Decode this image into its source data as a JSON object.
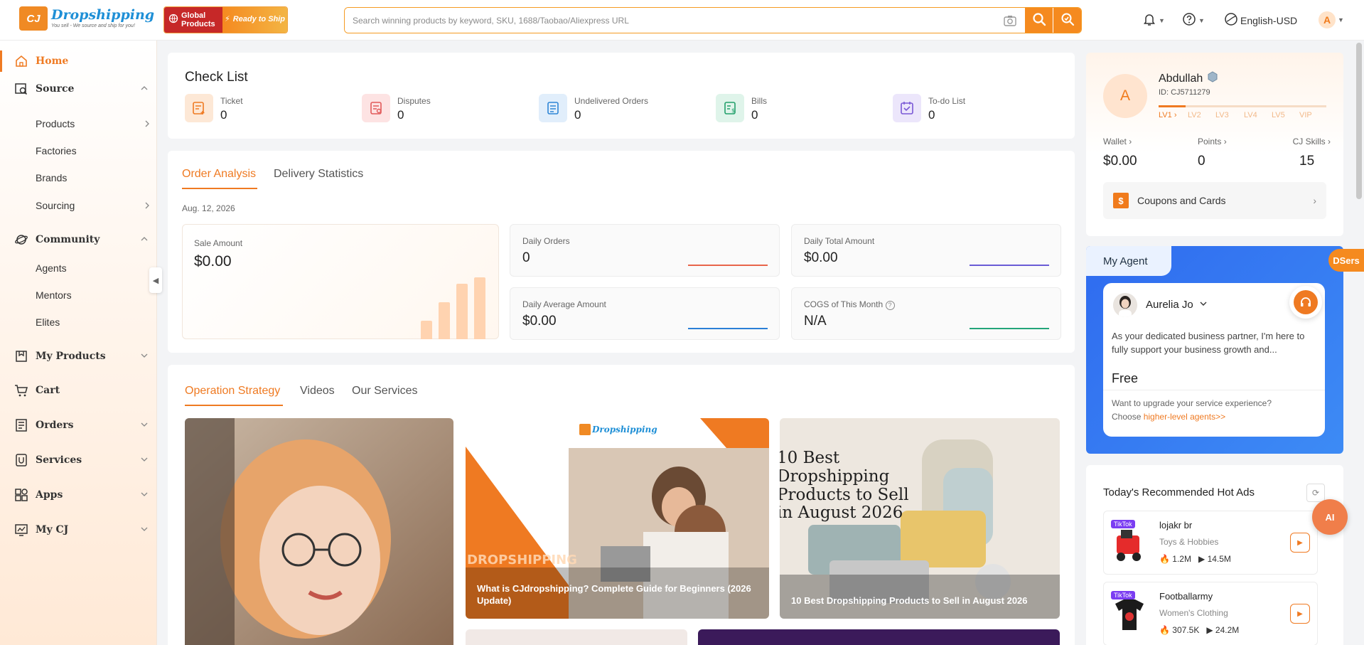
{
  "brand": {
    "name": "Dropshipping",
    "tagline": "You sell - We source and ship for you!",
    "mark": "CJ"
  },
  "promo": {
    "left": "Global Products",
    "right": "Ready to Ship"
  },
  "search": {
    "placeholder": "Search winning products by keyword, SKU, 1688/Taobao/Aliexpress URL"
  },
  "header": {
    "language": "English-USD",
    "avatar_letter": "A"
  },
  "sidebar": {
    "home": "Home",
    "source": "Source",
    "source_items": [
      "Products",
      "Factories",
      "Brands",
      "Sourcing"
    ],
    "community": "Community",
    "community_items": [
      "Agents",
      "Mentors",
      "Elites"
    ],
    "my_products": "My Products",
    "cart": "Cart",
    "orders": "Orders",
    "services": "Services",
    "apps": "Apps",
    "my_cj": "My CJ"
  },
  "checklist": {
    "title": "Check List",
    "items": [
      {
        "label": "Ticket",
        "value": "0"
      },
      {
        "label": "Disputes",
        "value": "0"
      },
      {
        "label": "Undelivered Orders",
        "value": "0"
      },
      {
        "label": "Bills",
        "value": "0"
      },
      {
        "label": "To-do List",
        "value": "0"
      }
    ]
  },
  "analysis": {
    "tabs": [
      "Order Analysis",
      "Delivery Statistics"
    ],
    "date": "Aug. 12, 2026",
    "sale_label": "Sale Amount",
    "sale_value": "$0.00",
    "stats": [
      {
        "label": "Daily Orders",
        "value": "0",
        "color": "#e8654a"
      },
      {
        "label": "Daily Total Amount",
        "value": "$0.00",
        "color": "#6a5bd6"
      },
      {
        "label": "Daily Average Amount",
        "value": "$0.00",
        "color": "#2b7fd6"
      },
      {
        "label": "COGS of This Month",
        "value": "N/A",
        "color": "#23a57a"
      }
    ]
  },
  "strategy": {
    "tabs": [
      "Operation Strategy",
      "Videos",
      "Our Services"
    ],
    "articles": [
      {
        "caption": ""
      },
      {
        "caption": "What is CJdropshipping? Complete Guide for Beginners (2026 Update)",
        "overlay": "DROPSHIPPING"
      },
      {
        "caption": "10 Best Dropshipping Products to Sell in August 2026",
        "headline": "10 Best Dropshipping Products to Sell in August 2026"
      }
    ]
  },
  "profile": {
    "name": "Abdullah",
    "avatar_letter": "A",
    "id": "ID: CJ5711279",
    "levels": [
      "LV1",
      "LV2",
      "LV3",
      "LV4",
      "LV5",
      "VIP"
    ],
    "wallet_label": "Wallet",
    "wallet_value": "$0.00",
    "points_label": "Points",
    "points_value": "0",
    "skills_label": "CJ Skills",
    "skills_value": "15",
    "coupons": "Coupons and Cards"
  },
  "agent": {
    "tab": "My Agent",
    "name": "Aurelia Jo",
    "message": "As your dedicated business partner, I'm here to fully support your business growth and...",
    "plan": "Free",
    "upgrade_text": "Want to upgrade your service experience?",
    "choose": "Choose",
    "link": "higher-level agents>>"
  },
  "hotads": {
    "title": "Today's Recommended Hot Ads",
    "items": [
      {
        "platform": "TikTok",
        "name": "lojakr br",
        "category": "Toys & Hobbies",
        "likes": "1.2M",
        "views": "14.5M"
      },
      {
        "platform": "TikTok",
        "name": "Footballarmy",
        "category": "Women's Clothing",
        "likes": "307.5K",
        "views": "24.2M"
      }
    ]
  },
  "floating": {
    "dsers": "DSers",
    "ai": "AI"
  }
}
